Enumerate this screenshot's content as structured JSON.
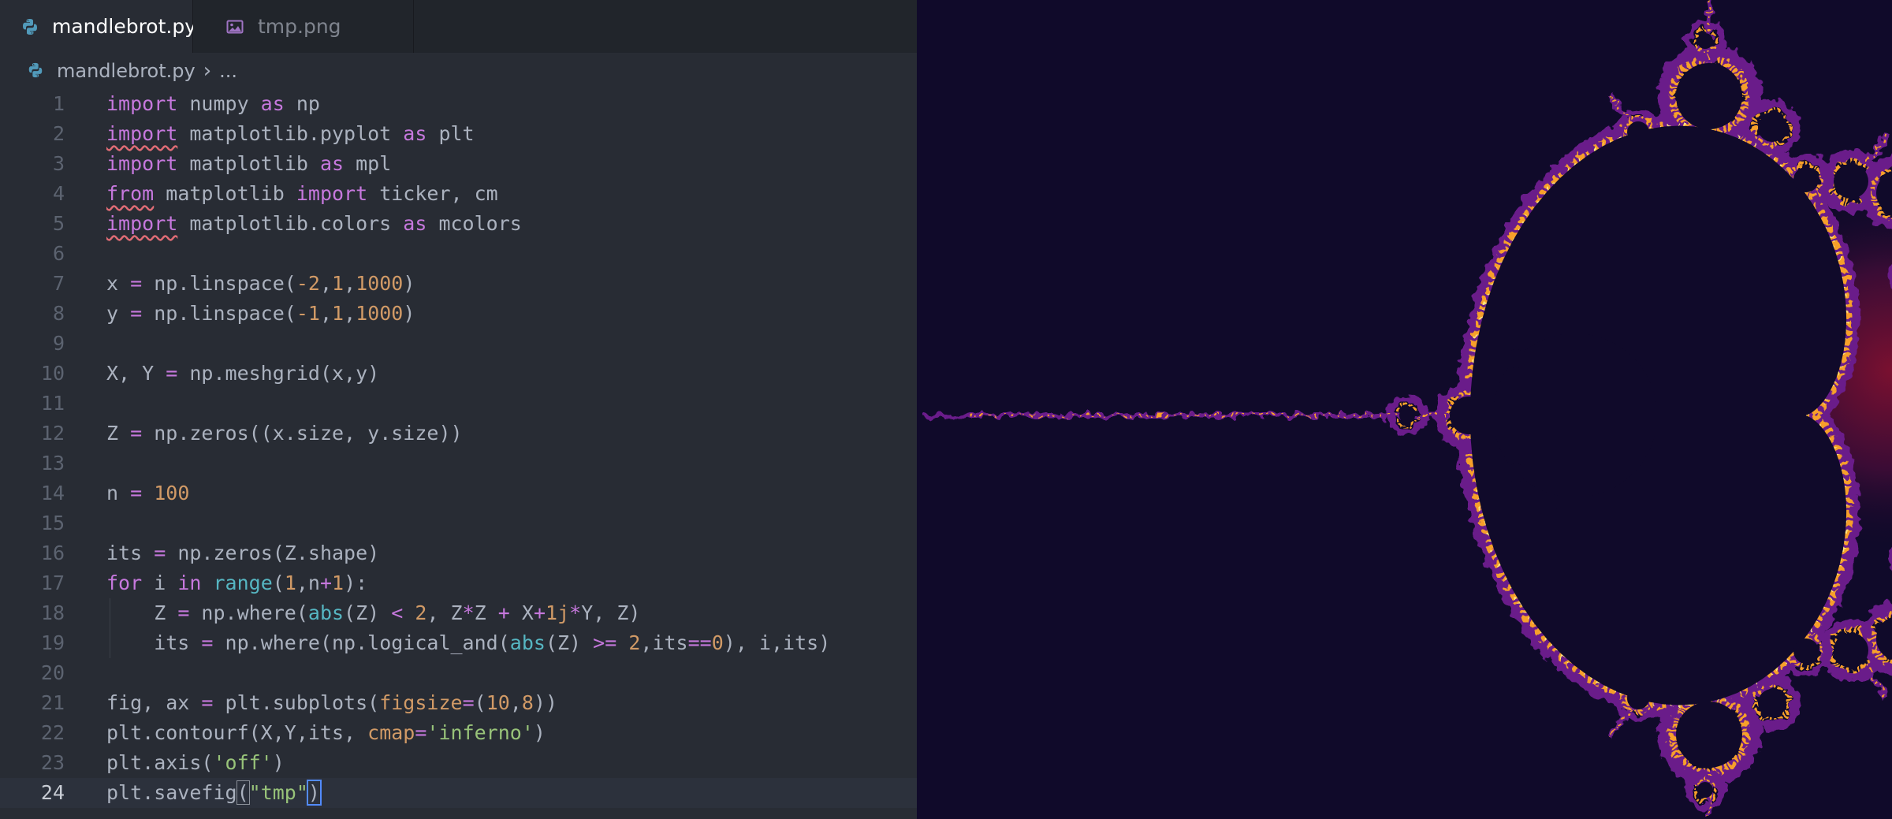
{
  "tabs": [
    {
      "label": "mandlebrot.py",
      "icon": "python-icon",
      "active": true,
      "close": "✕"
    },
    {
      "label": "tmp.png",
      "icon": "image-icon",
      "active": false
    }
  ],
  "breadcrumb": {
    "file": "mandlebrot.py",
    "separator": "›",
    "more": "..."
  },
  "editor": {
    "current_line": 24,
    "lines": [
      {
        "num": "1",
        "tokens": [
          {
            "t": "import",
            "c": "k"
          },
          {
            "t": " numpy "
          },
          {
            "t": "as",
            "c": "k"
          },
          {
            "t": " np"
          }
        ]
      },
      {
        "num": "2",
        "tokens": [
          {
            "t": "import",
            "c": "k sq"
          },
          {
            "t": " matplotlib.pyplot "
          },
          {
            "t": "as",
            "c": "k"
          },
          {
            "t": " plt"
          }
        ]
      },
      {
        "num": "3",
        "tokens": [
          {
            "t": "import",
            "c": "k"
          },
          {
            "t": " matplotlib "
          },
          {
            "t": "as",
            "c": "k"
          },
          {
            "t": " mpl"
          }
        ]
      },
      {
        "num": "4",
        "tokens": [
          {
            "t": "from",
            "c": "k sq"
          },
          {
            "t": " matplotlib "
          },
          {
            "t": "import",
            "c": "k"
          },
          {
            "t": " ticker, cm"
          }
        ]
      },
      {
        "num": "5",
        "tokens": [
          {
            "t": "import",
            "c": "k sq"
          },
          {
            "t": " matplotlib.colors "
          },
          {
            "t": "as",
            "c": "k"
          },
          {
            "t": " mcolors"
          }
        ]
      },
      {
        "num": "6",
        "tokens": []
      },
      {
        "num": "7",
        "tokens": [
          {
            "t": "x "
          },
          {
            "t": "=",
            "c": "o"
          },
          {
            "t": " np.linspace("
          },
          {
            "t": "-2",
            "c": "n"
          },
          {
            "t": ","
          },
          {
            "t": "1",
            "c": "n"
          },
          {
            "t": ","
          },
          {
            "t": "1000",
            "c": "n"
          },
          {
            "t": ")"
          }
        ]
      },
      {
        "num": "8",
        "tokens": [
          {
            "t": "y "
          },
          {
            "t": "=",
            "c": "o"
          },
          {
            "t": " np.linspace("
          },
          {
            "t": "-1",
            "c": "n"
          },
          {
            "t": ","
          },
          {
            "t": "1",
            "c": "n"
          },
          {
            "t": ","
          },
          {
            "t": "1000",
            "c": "n"
          },
          {
            "t": ")"
          }
        ]
      },
      {
        "num": "9",
        "tokens": []
      },
      {
        "num": "10",
        "tokens": [
          {
            "t": "X, Y "
          },
          {
            "t": "=",
            "c": "o"
          },
          {
            "t": " np.meshgrid(x,y)"
          }
        ]
      },
      {
        "num": "11",
        "tokens": []
      },
      {
        "num": "12",
        "tokens": [
          {
            "t": "Z "
          },
          {
            "t": "=",
            "c": "o"
          },
          {
            "t": " np.zeros((x.size, y.size))"
          }
        ]
      },
      {
        "num": "13",
        "tokens": []
      },
      {
        "num": "14",
        "tokens": [
          {
            "t": "n "
          },
          {
            "t": "=",
            "c": "o"
          },
          {
            "t": " "
          },
          {
            "t": "100",
            "c": "n"
          }
        ]
      },
      {
        "num": "15",
        "tokens": []
      },
      {
        "num": "16",
        "tokens": [
          {
            "t": "its "
          },
          {
            "t": "=",
            "c": "o"
          },
          {
            "t": " np.zeros(Z.shape)"
          }
        ]
      },
      {
        "num": "17",
        "tokens": [
          {
            "t": "for",
            "c": "k"
          },
          {
            "t": " i "
          },
          {
            "t": "in",
            "c": "k"
          },
          {
            "t": " "
          },
          {
            "t": "range",
            "c": "f"
          },
          {
            "t": "("
          },
          {
            "t": "1",
            "c": "n"
          },
          {
            "t": ",n"
          },
          {
            "t": "+",
            "c": "o"
          },
          {
            "t": "1",
            "c": "n"
          },
          {
            "t": "):"
          }
        ]
      },
      {
        "num": "18",
        "indent": true,
        "tokens": [
          {
            "t": "    Z "
          },
          {
            "t": "=",
            "c": "o"
          },
          {
            "t": " np.where("
          },
          {
            "t": "abs",
            "c": "f"
          },
          {
            "t": "(Z) "
          },
          {
            "t": "<",
            "c": "o"
          },
          {
            "t": " "
          },
          {
            "t": "2",
            "c": "n"
          },
          {
            "t": ", Z"
          },
          {
            "t": "*",
            "c": "o"
          },
          {
            "t": "Z "
          },
          {
            "t": "+",
            "c": "o"
          },
          {
            "t": " X"
          },
          {
            "t": "+",
            "c": "o"
          },
          {
            "t": "1j",
            "c": "n"
          },
          {
            "t": "*",
            "c": "o"
          },
          {
            "t": "Y, Z)"
          }
        ]
      },
      {
        "num": "19",
        "indent": true,
        "tokens": [
          {
            "t": "    its "
          },
          {
            "t": "=",
            "c": "o"
          },
          {
            "t": " np.where(np.logical_and("
          },
          {
            "t": "abs",
            "c": "f"
          },
          {
            "t": "(Z) "
          },
          {
            "t": ">=",
            "c": "o"
          },
          {
            "t": " "
          },
          {
            "t": "2",
            "c": "n"
          },
          {
            "t": ",its"
          },
          {
            "t": "==",
            "c": "o"
          },
          {
            "t": "0",
            "c": "n"
          },
          {
            "t": "), i,its)"
          }
        ]
      },
      {
        "num": "20",
        "tokens": []
      },
      {
        "num": "21",
        "tokens": [
          {
            "t": "fig, ax "
          },
          {
            "t": "=",
            "c": "o"
          },
          {
            "t": " plt.subplots("
          },
          {
            "t": "figsize",
            "c": "p"
          },
          {
            "t": "=",
            "c": "o"
          },
          {
            "t": "("
          },
          {
            "t": "10",
            "c": "n"
          },
          {
            "t": ","
          },
          {
            "t": "8",
            "c": "n"
          },
          {
            "t": "))"
          }
        ]
      },
      {
        "num": "22",
        "tokens": [
          {
            "t": "plt.contourf(X,Y,its, "
          },
          {
            "t": "cmap",
            "c": "p"
          },
          {
            "t": "=",
            "c": "o"
          },
          {
            "t": "'inferno'",
            "c": "s"
          },
          {
            "t": ")"
          }
        ]
      },
      {
        "num": "23",
        "tokens": [
          {
            "t": "plt.axis("
          },
          {
            "t": "'off'",
            "c": "s"
          },
          {
            "t": ")"
          }
        ]
      },
      {
        "num": "24",
        "tokens": [
          {
            "t": "plt.savefig"
          },
          {
            "t": "(",
            "c": "bracket"
          },
          {
            "t": "\"tmp\"",
            "c": "s"
          },
          {
            "t": ")",
            "c": "cursor-box"
          }
        ]
      }
    ]
  },
  "preview": {
    "content": "mandelbrot-fractal-render",
    "colormap": "inferno",
    "colors": {
      "background": "#100a2a",
      "edge_purple": "#6b1f8a",
      "edge_orange": "#f7a02a",
      "edge_yellow": "#fde47b",
      "glow": "#7a1030"
    }
  },
  "colors": {
    "editor_bg": "#282c34",
    "tabbar_bg": "#21252b",
    "keyword": "#c678dd",
    "number": "#d19a66",
    "string": "#98c379",
    "function": "#56b6c2"
  }
}
